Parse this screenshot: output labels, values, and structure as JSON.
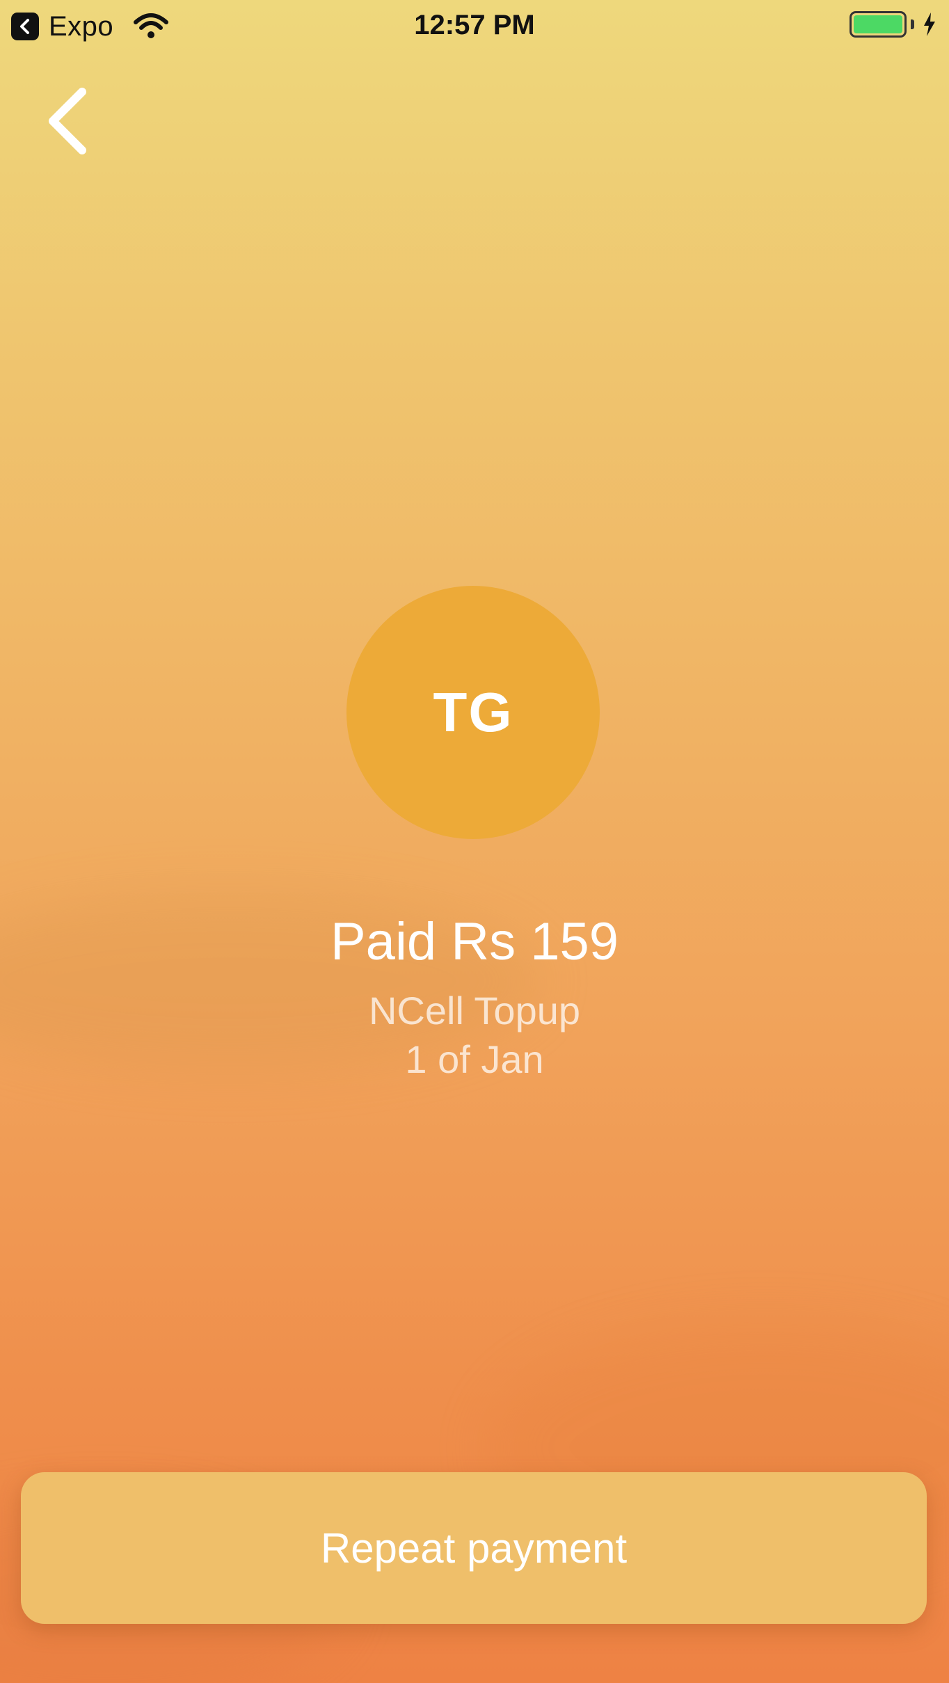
{
  "status_bar": {
    "app_label": "Expo",
    "time": "12:57 PM",
    "battery_level": 1.0,
    "charging": true,
    "icons": [
      "back-to-app-icon",
      "wifi-icon",
      "battery-icon",
      "charging-bolt-icon"
    ]
  },
  "nav": {
    "back_icon": "chevron-left-icon"
  },
  "payee": {
    "initials": "TG",
    "avatar_color": "#edaa38"
  },
  "payment": {
    "title": "Paid Rs 159",
    "service": "NCell Topup",
    "date": "1 of Jan"
  },
  "actions": {
    "repeat_label": "Repeat payment",
    "button_color": "#efbf6a"
  },
  "colors": {
    "gradient_top": "#eed87c",
    "gradient_bottom": "#ee8244",
    "battery_green": "#4cd964"
  }
}
